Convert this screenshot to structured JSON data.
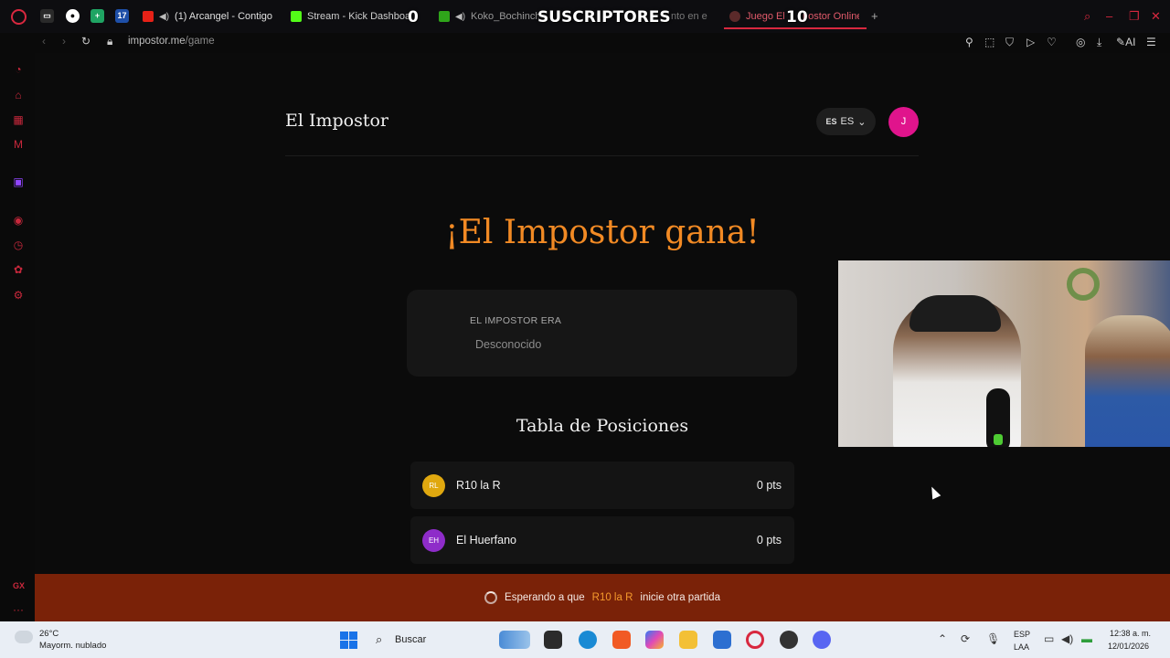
{
  "browser": {
    "tabs": [
      {
        "label": "(1) Arcangel - Contigo"
      },
      {
        "label": "Stream - Kick Dashboard"
      },
      {
        "label": "Koko_Bochinche"
      },
      {
        "label": "nto en e"
      },
      {
        "label": "Juego El"
      },
      {
        "label": "postor Online"
      }
    ],
    "overlay": {
      "count_left": "0",
      "title": "SUSCRIPTORES",
      "count_right": "10"
    },
    "url_host": "impostor.me",
    "url_path": "/game",
    "ai_label": "AI"
  },
  "header": {
    "brand": "El Impostor",
    "lang_flag": "ES",
    "lang_code": "ES",
    "avatar_initial": "J"
  },
  "result": {
    "title": "¡El Impostor gana!",
    "label": "EL IMPOSTOR ERA",
    "value": "Desconocido"
  },
  "leaderboard": {
    "title": "Tabla de Posiciones",
    "rows": [
      {
        "initials": "RL",
        "name": "R10 la R",
        "points": "0 pts",
        "color": "#e0a80f"
      },
      {
        "initials": "EH",
        "name": "El Huerfano",
        "points": "0 pts",
        "color": "#8e2cc9"
      }
    ]
  },
  "banner": {
    "prefix": "Esperando a que",
    "name": "R10 la R",
    "suffix": "inicie otra partida"
  },
  "sidebar": {
    "gx_label": "GX"
  },
  "taskbar": {
    "temperature": "26°C",
    "weather": "Mayorm. nublado",
    "search": "Buscar",
    "lang_1": "ESP",
    "lang_2": "LAA",
    "time": "12:38 a. m.",
    "date": "12/01/2026"
  },
  "colors": {
    "accent": "#f28a24",
    "opera_red": "#d8283f",
    "banner_bg": "#7a2208",
    "avatar": "#e0148c"
  }
}
